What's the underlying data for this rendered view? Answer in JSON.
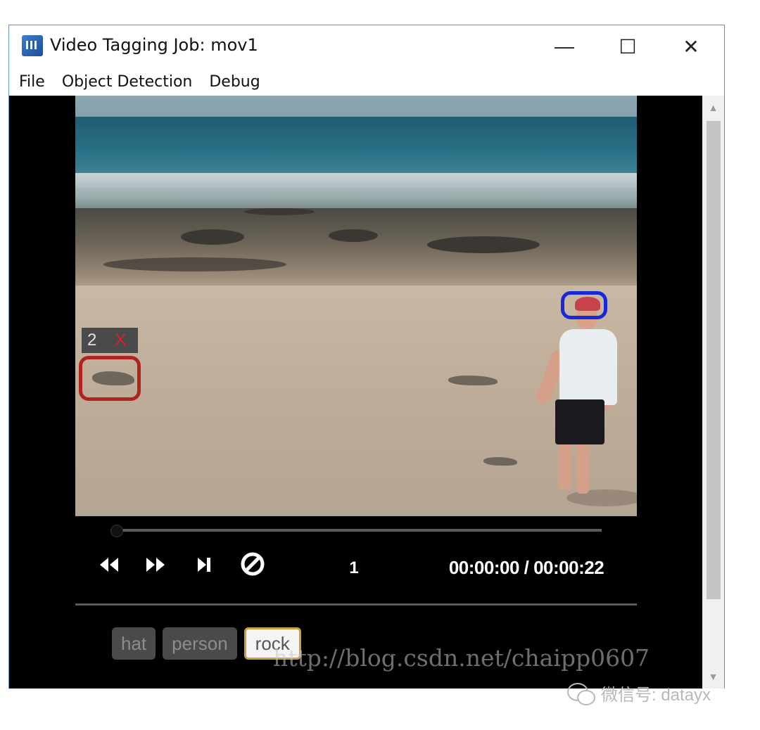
{
  "window": {
    "title": "Video Tagging Job: mov1",
    "controls": {
      "minimize": "—",
      "maximize": "☐",
      "close": "✕"
    }
  },
  "menu": [
    "File",
    "Object Detection",
    "Debug"
  ],
  "video": {
    "regions": [
      {
        "id": "2",
        "delete_label": "X",
        "color": "#b0231e",
        "tag": "rock"
      },
      {
        "color": "#1828d8",
        "tag": "hat"
      }
    ]
  },
  "player": {
    "progress": 0.0,
    "buttons": {
      "rewind": "⏪",
      "fast_forward": "⏩",
      "step": "⏭",
      "clear": "⊘"
    },
    "frame": "1",
    "time": "00:00:00 / 00:00:22"
  },
  "tags": [
    {
      "label": "hat",
      "active": false
    },
    {
      "label": "person",
      "active": false
    },
    {
      "label": "rock",
      "active": true
    }
  ],
  "watermark": "http://blog.csdn.net/chaipp0607",
  "wechat_caption": "微信号: datayx",
  "colors": {
    "accent_active_tag": "#caa040",
    "window_border": "#5a8fc7"
  }
}
